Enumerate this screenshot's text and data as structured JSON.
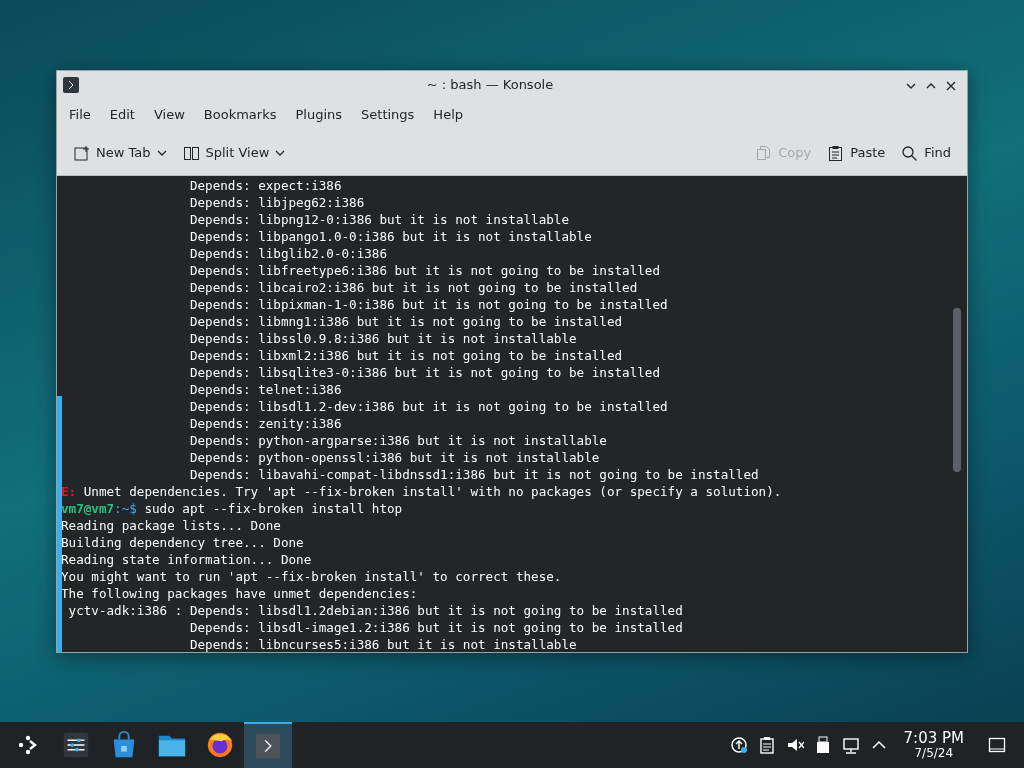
{
  "window": {
    "title": "~ : bash — Konsole"
  },
  "menu": [
    "File",
    "Edit",
    "View",
    "Bookmarks",
    "Plugins",
    "Settings",
    "Help"
  ],
  "toolbar": [
    {
      "label": "New Tab",
      "disabled": false,
      "dropdown": true
    },
    {
      "label": "Split View",
      "disabled": false,
      "dropdown": true
    },
    {
      "label": "Copy",
      "disabled": true,
      "dropdown": false
    },
    {
      "label": "Paste",
      "disabled": false,
      "dropdown": false
    },
    {
      "label": "Find",
      "disabled": false,
      "dropdown": false
    }
  ],
  "terminal": {
    "lines": [
      {
        "kind": "output",
        "text": "                 Depends: expect:i386"
      },
      {
        "kind": "output",
        "text": "                 Depends: libjpeg62:i386"
      },
      {
        "kind": "output",
        "text": "                 Depends: libpng12-0:i386 but it is not installable"
      },
      {
        "kind": "output",
        "text": "                 Depends: libpango1.0-0:i386 but it is not installable"
      },
      {
        "kind": "output",
        "text": "                 Depends: libglib2.0-0:i386"
      },
      {
        "kind": "output",
        "text": "                 Depends: libfreetype6:i386 but it is not going to be installed"
      },
      {
        "kind": "output",
        "text": "                 Depends: libcairo2:i386 but it is not going to be installed"
      },
      {
        "kind": "output",
        "text": "                 Depends: libpixman-1-0:i386 but it is not going to be installed"
      },
      {
        "kind": "output",
        "text": "                 Depends: libmng1:i386 but it is not going to be installed"
      },
      {
        "kind": "output",
        "text": "                 Depends: libssl0.9.8:i386 but it is not installable"
      },
      {
        "kind": "output",
        "text": "                 Depends: libxml2:i386 but it is not going to be installed"
      },
      {
        "kind": "output",
        "text": "                 Depends: libsqlite3-0:i386 but it is not going to be installed"
      },
      {
        "kind": "output",
        "text": "                 Depends: telnet:i386"
      },
      {
        "kind": "output",
        "text": "                 Depends: libsdl1.2-dev:i386 but it is not going to be installed"
      },
      {
        "kind": "output",
        "text": "                 Depends: zenity:i386"
      },
      {
        "kind": "output",
        "text": "                 Depends: python-argparse:i386 but it is not installable"
      },
      {
        "kind": "output",
        "text": "                 Depends: python-openssl:i386 but it is not installable"
      },
      {
        "kind": "output",
        "text": "                 Depends: libavahi-compat-libdnssd1:i386 but it is not going to be installed"
      },
      {
        "kind": "error",
        "prefix": "E:",
        "text": " Unmet dependencies. Try 'apt --fix-broken install' with no packages (or specify a solution)."
      },
      {
        "kind": "prompt",
        "user": "vm7@vm7",
        "path": ":~$",
        "text": " sudo apt --fix-broken install htop"
      },
      {
        "kind": "output",
        "text": "Reading package lists... Done"
      },
      {
        "kind": "output",
        "text": "Building dependency tree... Done"
      },
      {
        "kind": "output",
        "text": "Reading state information... Done"
      },
      {
        "kind": "output",
        "text": "You might want to run 'apt --fix-broken install' to correct these."
      },
      {
        "kind": "output",
        "text": "The following packages have unmet dependencies:"
      },
      {
        "kind": "output",
        "text": " yctv-adk:i386 : Depends: libsdl1.2debian:i386 but it is not going to be installed"
      },
      {
        "kind": "output",
        "text": "                 Depends: libsdl-image1.2:i386 but it is not going to be installed"
      },
      {
        "kind": "output",
        "text": "                 Depends: libncurses5:i386 but it is not installable"
      }
    ]
  },
  "taskbar": {
    "apps": [
      {
        "selected": false
      },
      {
        "selected": false
      },
      {
        "selected": false
      },
      {
        "selected": false
      },
      {
        "selected": true
      }
    ],
    "clock": {
      "time": "7:03 PM",
      "date": "7/5/24"
    }
  }
}
